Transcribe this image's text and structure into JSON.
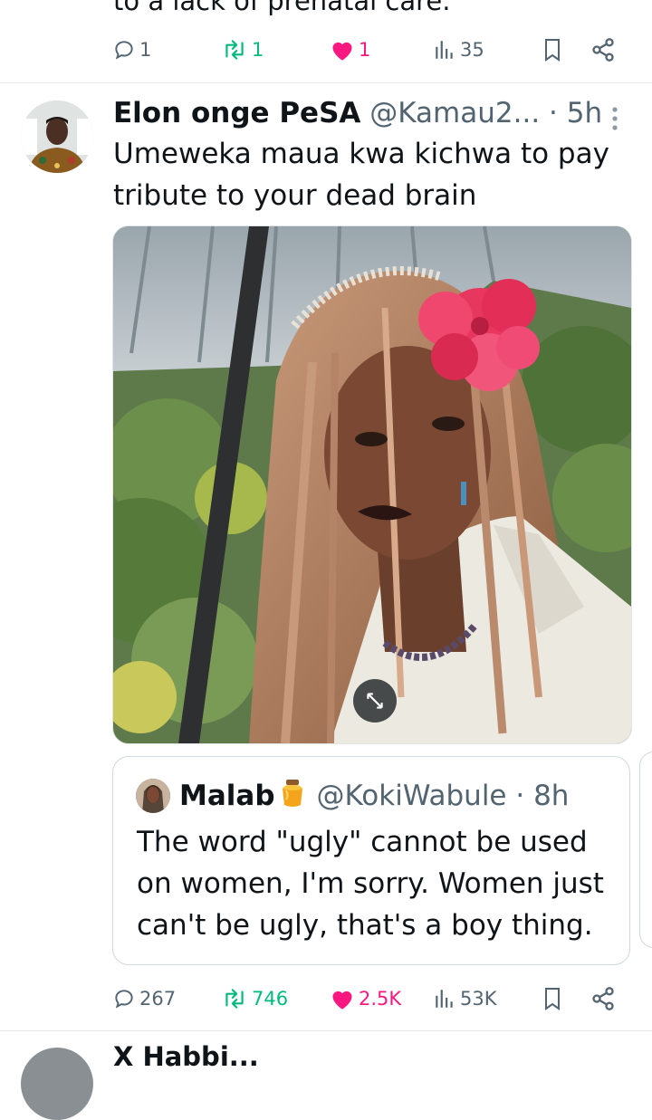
{
  "prev_tweet": {
    "cut_text": "to a lack of prenatal care.",
    "actions": {
      "replies": "1",
      "reposts": "1",
      "likes": "1",
      "views": "35"
    }
  },
  "tweet": {
    "author_name": "Elon onge PeSA",
    "author_handle": "@Kamau2...",
    "time": "· 5h",
    "text": "Umeweka maua kwa kichwa to pay tribute to your dead brain",
    "actions": {
      "replies": "267",
      "reposts": "746",
      "likes": "2.5K",
      "views": "53K"
    },
    "quote": {
      "author_name": "Malab",
      "author_handle": "@KokiWabule",
      "time": "· 8h",
      "text": "The word \"ugly\" cannot be used on women, I'm sorry. Women just can't be ugly, that's a boy thing."
    }
  },
  "next_tweet": {
    "cut_text": "X Habbi..."
  },
  "colors": {
    "repost_green": "#00ba7c",
    "like_pink": "#f91880",
    "muted": "#536471",
    "text": "#0f1419"
  },
  "icons": [
    "reply-icon",
    "repost-icon",
    "like-icon",
    "views-icon",
    "bookmark-icon",
    "share-icon",
    "more-icon",
    "expand-icon",
    "honey-pot-emoji"
  ]
}
